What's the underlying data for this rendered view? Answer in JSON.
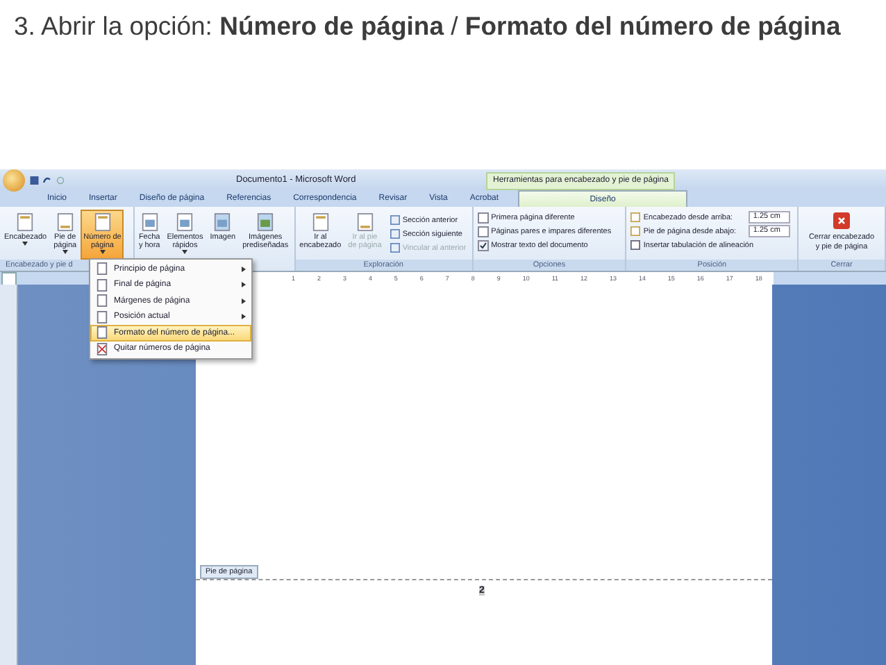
{
  "heading": {
    "text": "3. Abrir la opción: **Número de página** / **Formato del número de página**"
  },
  "window": {
    "title": "Documento1 - Microsoft Word",
    "context_title": "Herramientas para encabezado y pie de página"
  },
  "tabs": [
    {
      "label": "Inicio",
      "selected": false,
      "contextual": false
    },
    {
      "label": "Insertar",
      "selected": false,
      "contextual": false
    },
    {
      "label": "Diseño de página",
      "selected": false,
      "contextual": false
    },
    {
      "label": "Referencias",
      "selected": false,
      "contextual": false
    },
    {
      "label": "Correspondencia",
      "selected": false,
      "contextual": false
    },
    {
      "label": "Revisar",
      "selected": false,
      "contextual": false
    },
    {
      "label": "Vista",
      "selected": false,
      "contextual": false
    },
    {
      "label": "Acrobat",
      "selected": false,
      "contextual": false
    },
    {
      "label": "Diseño",
      "selected": true,
      "contextual": true
    }
  ],
  "ribbon": {
    "header_footer_group": {
      "label": "Encabezado y pie d",
      "buttons": [
        {
          "lines": [
            "Encabezado"
          ],
          "dropdown": true,
          "selected": false
        },
        {
          "lines": [
            "Pie de",
            "página"
          ],
          "dropdown": true,
          "selected": false
        },
        {
          "lines": [
            "Número de",
            "página"
          ],
          "dropdown": true,
          "selected": true
        }
      ]
    },
    "insert_group": {
      "buttons": [
        {
          "lines": [
            "Fecha",
            "y hora"
          ],
          "dropdown": false,
          "selected": false
        },
        {
          "lines": [
            "Elementos",
            "rápidos"
          ],
          "dropdown": true,
          "selected": false
        },
        {
          "lines": [
            "Imagen"
          ],
          "dropdown": false,
          "selected": false
        },
        {
          "lines": [
            "Imágenes",
            "prediseñadas"
          ],
          "dropdown": false,
          "selected": false
        }
      ]
    },
    "navigation_group": {
      "label": "Exploración",
      "buttons": [
        {
          "lines": [
            "Ir al",
            "encabezado"
          ],
          "disabled": false
        },
        {
          "lines": [
            "Ir al pie",
            "de página"
          ],
          "disabled": true
        }
      ],
      "items": [
        {
          "label": "Sección anterior",
          "disabled": false
        },
        {
          "label": "Sección siguiente",
          "disabled": false
        },
        {
          "label": "Vincular al anterior",
          "disabled": true
        }
      ]
    },
    "options_group": {
      "label": "Opciones",
      "checkboxes": [
        {
          "label": "Primera página diferente",
          "checked": false
        },
        {
          "label": "Páginas pares e impares diferentes",
          "checked": false
        },
        {
          "label": "Mostrar texto del documento",
          "checked": true
        }
      ]
    },
    "position_group": {
      "label": "Posición",
      "fields": [
        {
          "label": "Encabezado desde arriba:",
          "value": "1.25 cm"
        },
        {
          "label": "Pie de página desde abajo:",
          "value": "1.25 cm"
        }
      ],
      "command": "Insertar tabulación de alineación"
    },
    "close_group": {
      "label": "Cerrar",
      "button": "Cerrar encabezado y pie de página"
    }
  },
  "menu": {
    "items": [
      {
        "label": "Principio de página",
        "submenu": true,
        "selected": false
      },
      {
        "label": "Final de página",
        "submenu": true,
        "selected": false
      },
      {
        "label": "Márgenes de página",
        "submenu": true,
        "selected": false
      },
      {
        "label": "Posición actual",
        "submenu": true,
        "selected": false
      },
      {
        "label": "Formato del número de página...",
        "submenu": false,
        "selected": true
      },
      {
        "label": "Quitar números de página",
        "submenu": false,
        "selected": false
      }
    ]
  },
  "ruler": {
    "numbers": [
      "1",
      "2",
      "3",
      "4",
      "5",
      "6",
      "7",
      "8",
      "9",
      "10",
      "11",
      "12",
      "13",
      "14",
      "15",
      "16",
      "17",
      "18"
    ]
  },
  "document": {
    "footer_tag": "Pie de página",
    "page_number": "2"
  }
}
